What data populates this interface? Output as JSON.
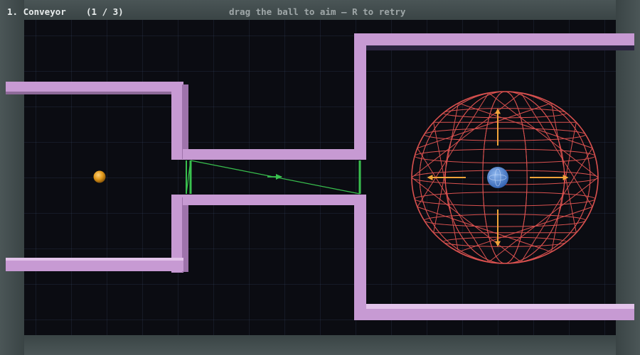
{
  "hud": {
    "level_title": "1. Conveyor",
    "level_progress": "(1 / 3)",
    "instructions": "drag the ball to aim — R to retry"
  },
  "colors": {
    "wall": "#c79ad3",
    "wall_shade": "#9e73ab",
    "wall_top": "#e3c3ea",
    "conveyor": "#39c04e",
    "goal_mesh": "#d9514f",
    "goal_arrows": "#f0a43a",
    "goal_core": "#4d86d6",
    "ball": "#e39a1c"
  },
  "scene": {
    "ball_icon": "orange-ball",
    "goal_icon": "wireframe-goal-sphere",
    "force_direction": "outward"
  }
}
